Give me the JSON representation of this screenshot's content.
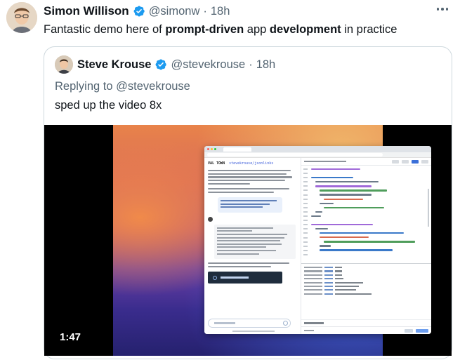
{
  "tweet": {
    "author_name": "Simon Willison",
    "author_handle": "@simonw",
    "separator": "·",
    "timestamp": "18h",
    "text_parts": [
      "Fantastic demo here of ",
      "prompt-driven",
      " app ",
      "development",
      " in practice"
    ],
    "more_icon": "more-horizontal-icon",
    "verified_icon": "verified-badge-icon"
  },
  "quoted_tweet": {
    "author_name": "Steve Krouse",
    "author_handle": "@stevekrouse",
    "separator": "·",
    "timestamp": "18h",
    "replying_to": "Replying to @stevekrouse",
    "text": "sped up the video 8x"
  },
  "video": {
    "duration": "1:47"
  },
  "colors": {
    "verified_blue": "#1d9bf0",
    "secondary_text": "#536471",
    "primary_text": "#0f1419",
    "border": "#cfd9de"
  }
}
